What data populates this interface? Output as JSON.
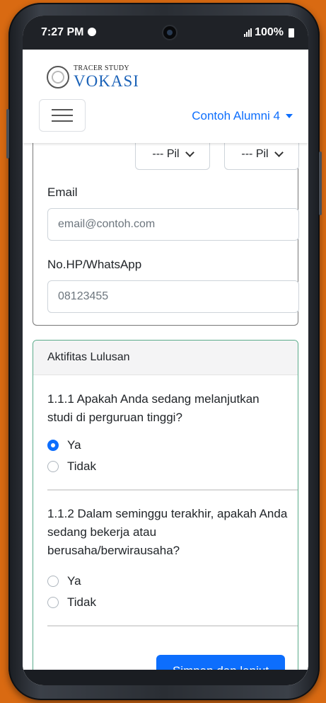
{
  "status_bar": {
    "time": "7:27 PM",
    "battery": "100%"
  },
  "navbar": {
    "brand_small": "TRACER STUDY",
    "brand_big": "VOKASI",
    "user_menu": "Contoh Alumni 4"
  },
  "form": {
    "select_1": "--- Pil",
    "select_2": "--- Pil",
    "email_label": "Email",
    "email_placeholder": "email@contoh.com",
    "phone_label": "No.HP/WhatsApp",
    "phone_value": "08123455"
  },
  "activity": {
    "header": "Aktifitas Lulusan",
    "q1": "1.1.1 Apakah Anda sedang melanjutkan studi di perguruan tinggi?",
    "q1_options": [
      "Ya",
      "Tidak"
    ],
    "q1_selected": "Ya",
    "q2": "1.1.2 Dalam seminggu terakhir, apakah Anda sedang bekerja atau berusaha/berwirausaha?",
    "q2_options": [
      "Ya",
      "Tidak"
    ],
    "submit_label": "Simpan dan lanjut"
  },
  "colors": {
    "accent": "#0d6efd",
    "background": "#d96a12",
    "card_border": "#5aaa8a"
  }
}
